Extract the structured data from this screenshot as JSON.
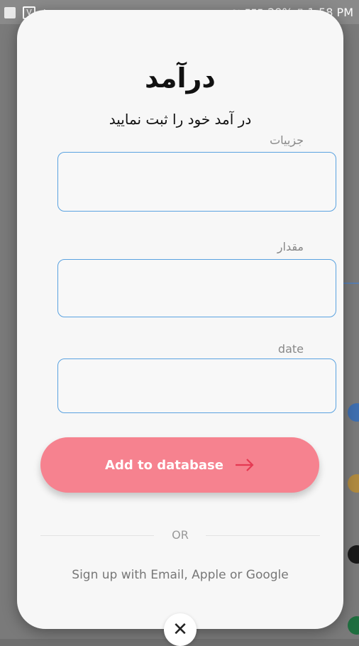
{
  "status_bar": {
    "battery": "29%",
    "time": "1:58 PM"
  },
  "modal": {
    "title": "درآمد",
    "subtitle": "در آمد خود را ثبت نمایید",
    "fields": [
      {
        "label": "جزییات",
        "value": ""
      },
      {
        "label": "مقدار",
        "value": ""
      },
      {
        "label": "date",
        "value": ""
      }
    ],
    "submit_label": "Add to database",
    "or_text": "OR",
    "signup_text": "Sign up with Email, Apple or Google",
    "close_symbol": "✕"
  },
  "colors": {
    "button": "#f6828f",
    "field_border": "#5aa2e0",
    "modal_bg": "#f7f7f7"
  },
  "icons": [
    "image-icon",
    "v-icon",
    "send-icon",
    "wifi-icon",
    "signal-icon",
    "battery-icon",
    "arrow-right-icon",
    "close-icon"
  ]
}
